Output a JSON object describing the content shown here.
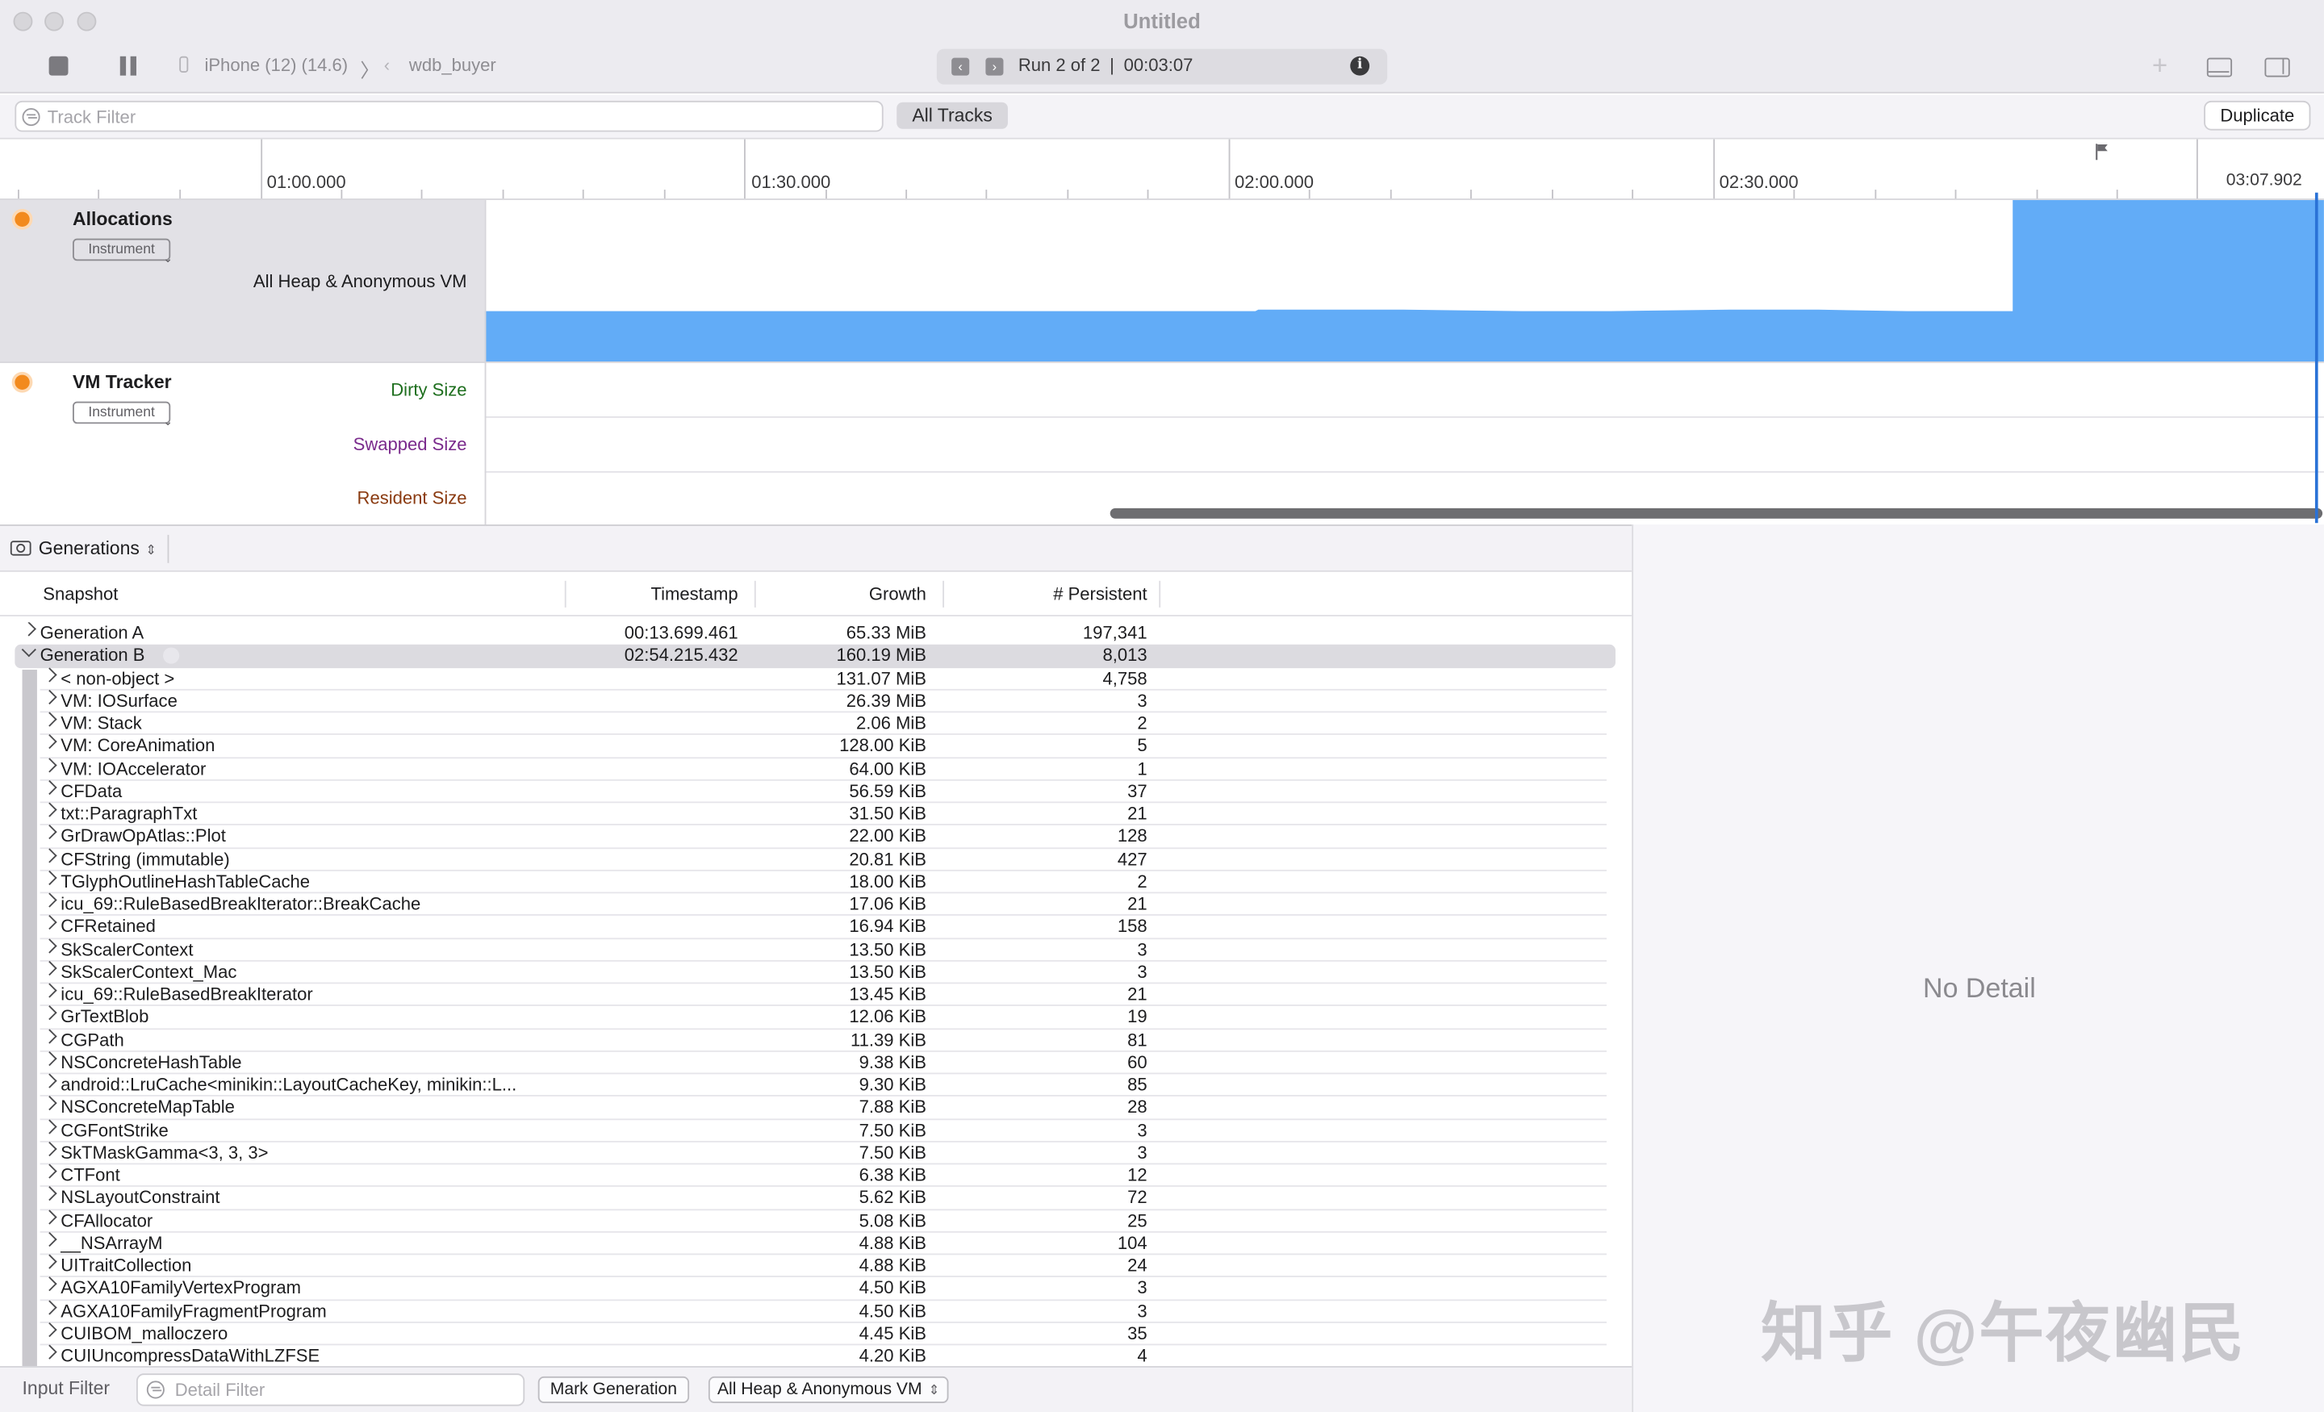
{
  "window": {
    "title": "Untitled"
  },
  "toolbar": {
    "target_device": "iPhone (12) (14.6)",
    "target_app": "wdb_buyer",
    "run_label": "Run 2 of 2",
    "separator": "|",
    "run_time": "00:03:07"
  },
  "filterbar": {
    "track_filter_placeholder": "Track Filter",
    "all_tracks_label": "All Tracks",
    "duplicate_label": "Duplicate"
  },
  "ruler": {
    "labels": [
      "01:00.000",
      "01:30.000",
      "02:00.000",
      "02:30.000",
      "03:07.902"
    ]
  },
  "tracks": {
    "allocations": {
      "name": "Allocations",
      "tag": "Instrument",
      "sublabel": "All Heap & Anonymous VM"
    },
    "vm_tracker": {
      "name": "VM Tracker",
      "tag": "Instrument",
      "sublabels": [
        "Dirty Size",
        "Swapped Size",
        "Resident Size"
      ]
    }
  },
  "colors": {
    "graph_fill": "#62acf7",
    "dirty": "#1d6e1d",
    "swapped": "#7a2a8c",
    "resident": "#8a3a10",
    "instrument_icon": "#f28a1e"
  },
  "panel": {
    "mode_label": "Generations",
    "columns": [
      "Snapshot",
      "Timestamp",
      "Growth",
      "# Persistent"
    ],
    "generations": [
      {
        "name": "Generation A",
        "timestamp": "00:13.699.461",
        "growth": "65.33 MiB",
        "persistent": "197,341",
        "expanded": false
      },
      {
        "name": "Generation B",
        "timestamp": "02:54.215.432",
        "growth": "160.19 MiB",
        "persistent": "8,013",
        "expanded": true
      }
    ],
    "children": [
      {
        "name": "< non-object >",
        "growth": "131.07 MiB",
        "persistent": "4,758"
      },
      {
        "name": "VM: IOSurface",
        "growth": "26.39 MiB",
        "persistent": "3"
      },
      {
        "name": "VM: Stack",
        "growth": "2.06 MiB",
        "persistent": "2"
      },
      {
        "name": "VM: CoreAnimation",
        "growth": "128.00 KiB",
        "persistent": "5"
      },
      {
        "name": "VM: IOAccelerator",
        "growth": "64.00 KiB",
        "persistent": "1"
      },
      {
        "name": "CFData",
        "growth": "56.59 KiB",
        "persistent": "37"
      },
      {
        "name": "txt::ParagraphTxt",
        "growth": "31.50 KiB",
        "persistent": "21"
      },
      {
        "name": "GrDrawOpAtlas::Plot",
        "growth": "22.00 KiB",
        "persistent": "128"
      },
      {
        "name": "CFString (immutable)",
        "growth": "20.81 KiB",
        "persistent": "427"
      },
      {
        "name": "TGlyphOutlineHashTableCache",
        "growth": "18.00 KiB",
        "persistent": "2"
      },
      {
        "name": "icu_69::RuleBasedBreakIterator::BreakCache",
        "growth": "17.06 KiB",
        "persistent": "21"
      },
      {
        "name": "CFRetained",
        "growth": "16.94 KiB",
        "persistent": "158"
      },
      {
        "name": "SkScalerContext",
        "growth": "13.50 KiB",
        "persistent": "3"
      },
      {
        "name": "SkScalerContext_Mac",
        "growth": "13.50 KiB",
        "persistent": "3"
      },
      {
        "name": "icu_69::RuleBasedBreakIterator",
        "growth": "13.45 KiB",
        "persistent": "21"
      },
      {
        "name": "GrTextBlob",
        "growth": "12.06 KiB",
        "persistent": "19"
      },
      {
        "name": "CGPath",
        "growth": "11.39 KiB",
        "persistent": "81"
      },
      {
        "name": "NSConcreteHashTable",
        "growth": "9.38 KiB",
        "persistent": "60"
      },
      {
        "name": "android::LruCache<minikin::LayoutCacheKey, minikin::L...",
        "growth": "9.30 KiB",
        "persistent": "85"
      },
      {
        "name": "NSConcreteMapTable",
        "growth": "7.88 KiB",
        "persistent": "28"
      },
      {
        "name": "CGFontStrike",
        "growth": "7.50 KiB",
        "persistent": "3"
      },
      {
        "name": "SkTMaskGamma<3, 3, 3>",
        "growth": "7.50 KiB",
        "persistent": "3"
      },
      {
        "name": "CTFont",
        "growth": "6.38 KiB",
        "persistent": "12"
      },
      {
        "name": "NSLayoutConstraint",
        "growth": "5.62 KiB",
        "persistent": "72"
      },
      {
        "name": "CFAllocator",
        "growth": "5.08 KiB",
        "persistent": "25"
      },
      {
        "name": "__NSArrayM",
        "growth": "4.88 KiB",
        "persistent": "104"
      },
      {
        "name": "UITraitCollection",
        "growth": "4.88 KiB",
        "persistent": "24"
      },
      {
        "name": "AGXA10FamilyVertexProgram",
        "growth": "4.50 KiB",
        "persistent": "3"
      },
      {
        "name": "AGXA10FamilyFragmentProgram",
        "growth": "4.50 KiB",
        "persistent": "3"
      },
      {
        "name": "CUIBOM_malloczero",
        "growth": "4.45 KiB",
        "persistent": "35"
      },
      {
        "name": "CUIUncompressDataWithLZFSE",
        "growth": "4.20 KiB",
        "persistent": "4"
      }
    ]
  },
  "detail": {
    "empty_label": "No Detail"
  },
  "bottombar": {
    "input_filter_label": "Input Filter",
    "detail_filter_placeholder": "Detail Filter",
    "mark_generation_label": "Mark Generation",
    "heap_select_value": "All Heap & Anonymous VM"
  },
  "watermark": {
    "text": "知乎 @午夜幽民"
  }
}
